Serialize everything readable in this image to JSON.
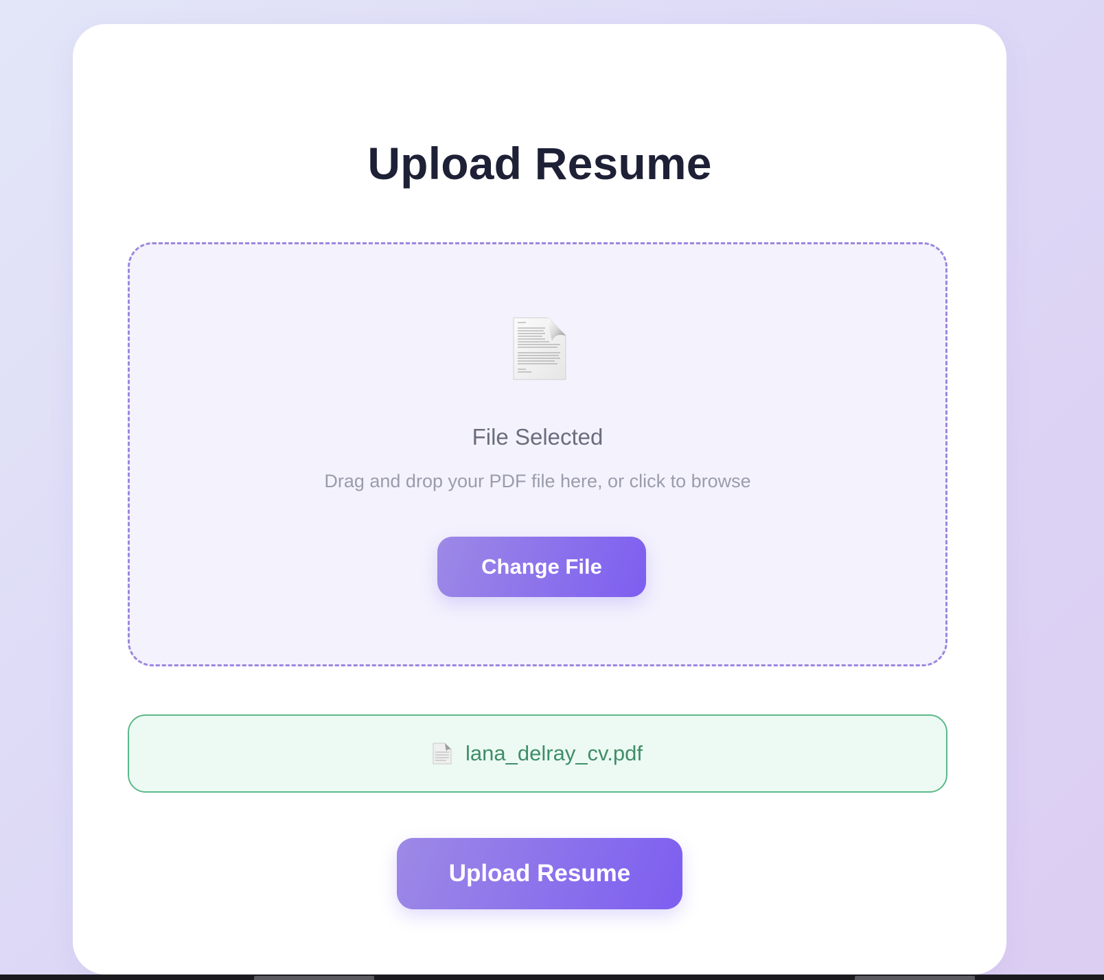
{
  "page": {
    "title": "Upload Resume"
  },
  "dropzone": {
    "icon": "document-icon",
    "title": "File Selected",
    "hint": "Drag and drop your PDF file here, or click to browse",
    "change_button_label": "Change File"
  },
  "selected_file": {
    "icon": "document-icon",
    "name": "lana_delray_cv.pdf"
  },
  "actions": {
    "upload_button_label": "Upload Resume"
  },
  "colors": {
    "accent_start": "#9d89e6",
    "accent_end": "#7d5ef0",
    "dropzone_border": "#9b86de",
    "dropzone_bg": "#f4f2fd",
    "success_border": "#5bb889",
    "success_bg": "#edfaf3",
    "success_text": "#3f8e68",
    "title_text": "#1e2036"
  }
}
